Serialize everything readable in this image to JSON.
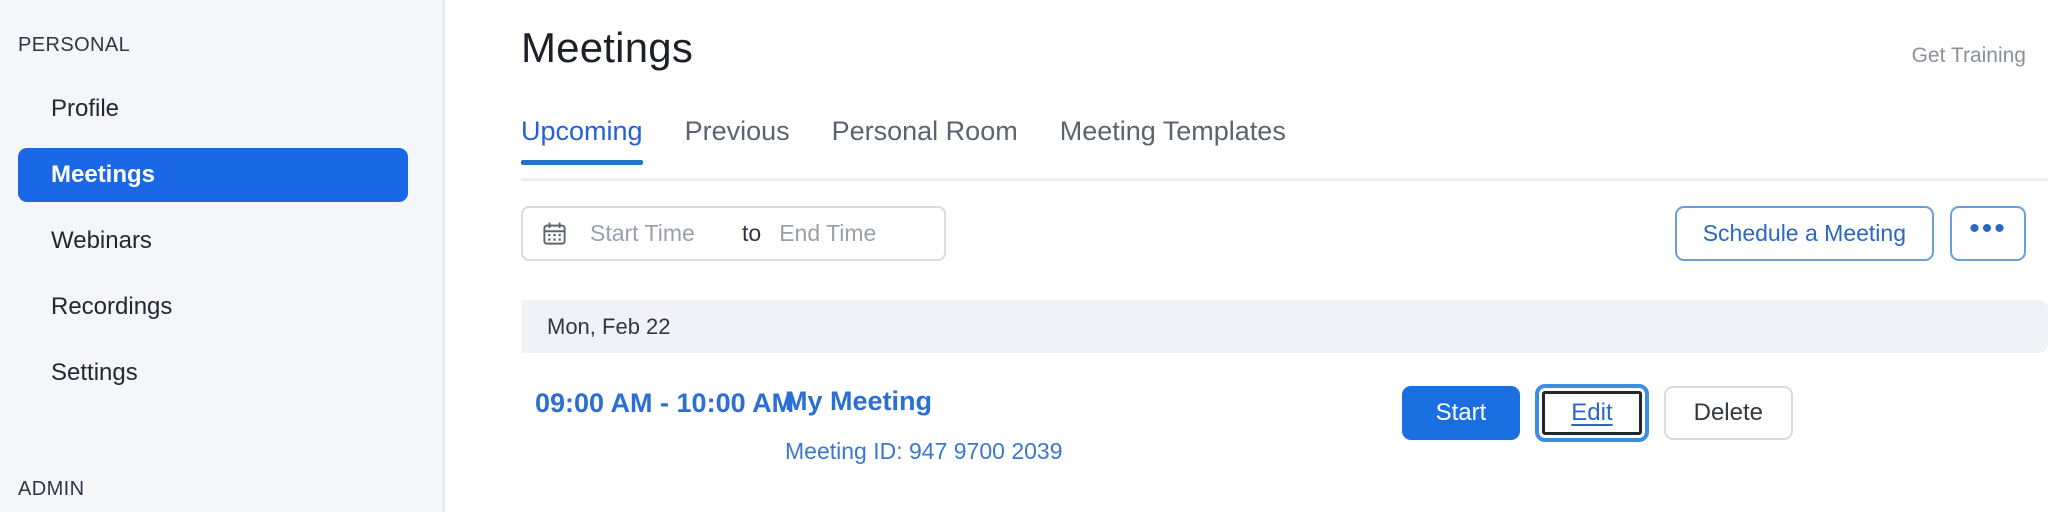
{
  "sidebar": {
    "groups": [
      {
        "label": "PERSONAL"
      },
      {
        "label": "ADMIN"
      }
    ],
    "items": [
      {
        "label": "Profile",
        "active": false
      },
      {
        "label": "Meetings",
        "active": true
      },
      {
        "label": "Webinars",
        "active": false
      },
      {
        "label": "Recordings",
        "active": false
      },
      {
        "label": "Settings",
        "active": false
      }
    ],
    "accent_color": "#1a68e5",
    "background_color": "#f5f6f9"
  },
  "header": {
    "title": "Meetings",
    "get_training": "Get Training"
  },
  "tabs": [
    {
      "label": "Upcoming",
      "active": true
    },
    {
      "label": "Previous",
      "active": false
    },
    {
      "label": "Personal Room",
      "active": false
    },
    {
      "label": "Meeting Templates",
      "active": false
    }
  ],
  "filters": {
    "calendar_icon": "calendar-icon",
    "start_time": {
      "value": "",
      "placeholder": "Start Time"
    },
    "separator": "to",
    "end_time": {
      "value": "",
      "placeholder": "End Time"
    },
    "schedule_button": "Schedule a Meeting",
    "more_button": "•••",
    "more_icon": "ellipsis-icon"
  },
  "list": {
    "date_groups": [
      {
        "date_label": "Mon, Feb 22",
        "meetings": [
          {
            "time": "09:00 AM - 10:00 AM",
            "title": "My Meeting",
            "meeting_id": "Meeting ID: 947 9700 2039",
            "actions": {
              "start": "Start",
              "edit": "Edit",
              "delete": "Delete"
            }
          }
        ]
      }
    ]
  },
  "colors": {
    "primary_blue": "#1a6fe0",
    "link_blue": "#2b68c4",
    "focus_ring": "#3b8ee0",
    "band_gray": "#f1f2f8"
  }
}
